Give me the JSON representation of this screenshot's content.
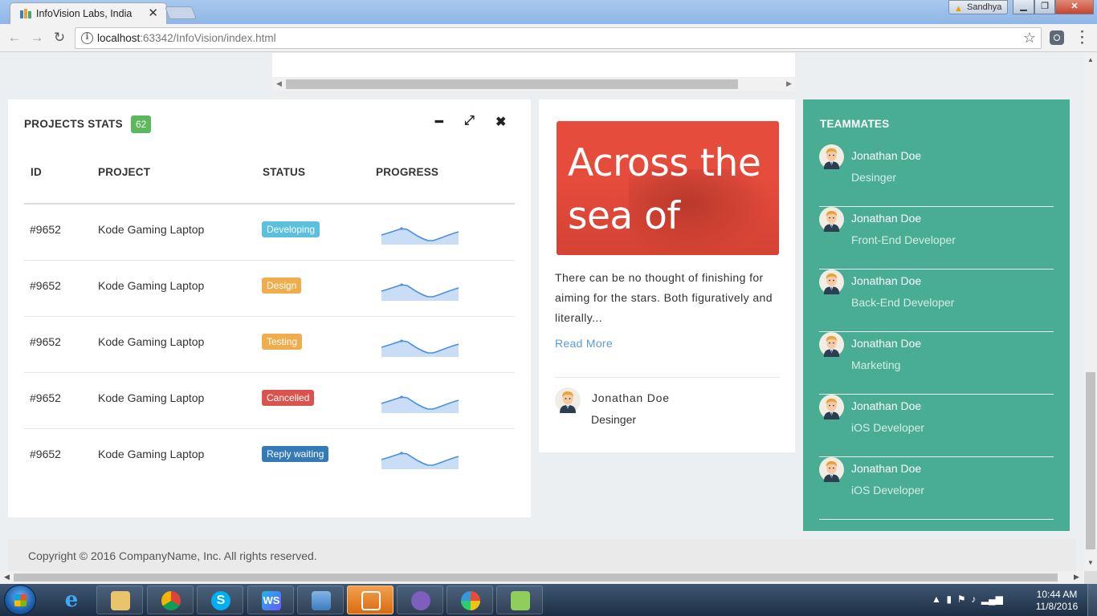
{
  "browser": {
    "tab_title": "InfoVision Labs, India",
    "url_host": "localhost",
    "url_rest": ":63342/InfoVision/index.html",
    "profile_name": "Sandhya"
  },
  "projects": {
    "title": "PROJECTS STATS",
    "count": "62",
    "columns": [
      "ID",
      "PROJECT",
      "STATUS",
      "PROGRESS"
    ],
    "rows": [
      {
        "id": "#9652",
        "project": "Kode Gaming Laptop",
        "status": "Developing",
        "status_color": "#5bc0de"
      },
      {
        "id": "#9652",
        "project": "Kode Gaming Laptop",
        "status": "Design",
        "status_color": "#f0ad4e"
      },
      {
        "id": "#9652",
        "project": "Kode Gaming Laptop",
        "status": "Testing",
        "status_color": "#f0ad4e"
      },
      {
        "id": "#9652",
        "project": "Kode Gaming Laptop",
        "status": "Cancelled",
        "status_color": "#d9534f"
      },
      {
        "id": "#9652",
        "project": "Kode Gaming Laptop",
        "status": "Reply waiting",
        "status_color": "#337ab7"
      }
    ]
  },
  "blog": {
    "image_text": "Across the sea of",
    "excerpt": "There can be no thought of finishing for aiming for the stars. Both figuratively and literally...",
    "read_more": "Read More",
    "author_name": "Jonathan Doe",
    "author_role": "Desinger"
  },
  "teammates": {
    "title": "TEAMMATES",
    "members": [
      {
        "name": "Jonathan Doe",
        "role": "Desinger"
      },
      {
        "name": "Jonathan Doe",
        "role": "Front-End Developer"
      },
      {
        "name": "Jonathan Doe",
        "role": "Back-End Developer"
      },
      {
        "name": "Jonathan Doe",
        "role": "Marketing"
      },
      {
        "name": "Jonathan Doe",
        "role": "iOS Developer"
      },
      {
        "name": "Jonathan Doe",
        "role": "iOS Developer"
      }
    ]
  },
  "footer": {
    "copyright": "Copyright © 2016 CompanyName, Inc. All rights reserved."
  },
  "taskbar": {
    "time": "10:44 AM",
    "date": "11/8/2016"
  },
  "colors": {
    "accent_green": "#48ad93",
    "badge_green": "#5cb85c",
    "link_blue": "#5b9bd5"
  }
}
